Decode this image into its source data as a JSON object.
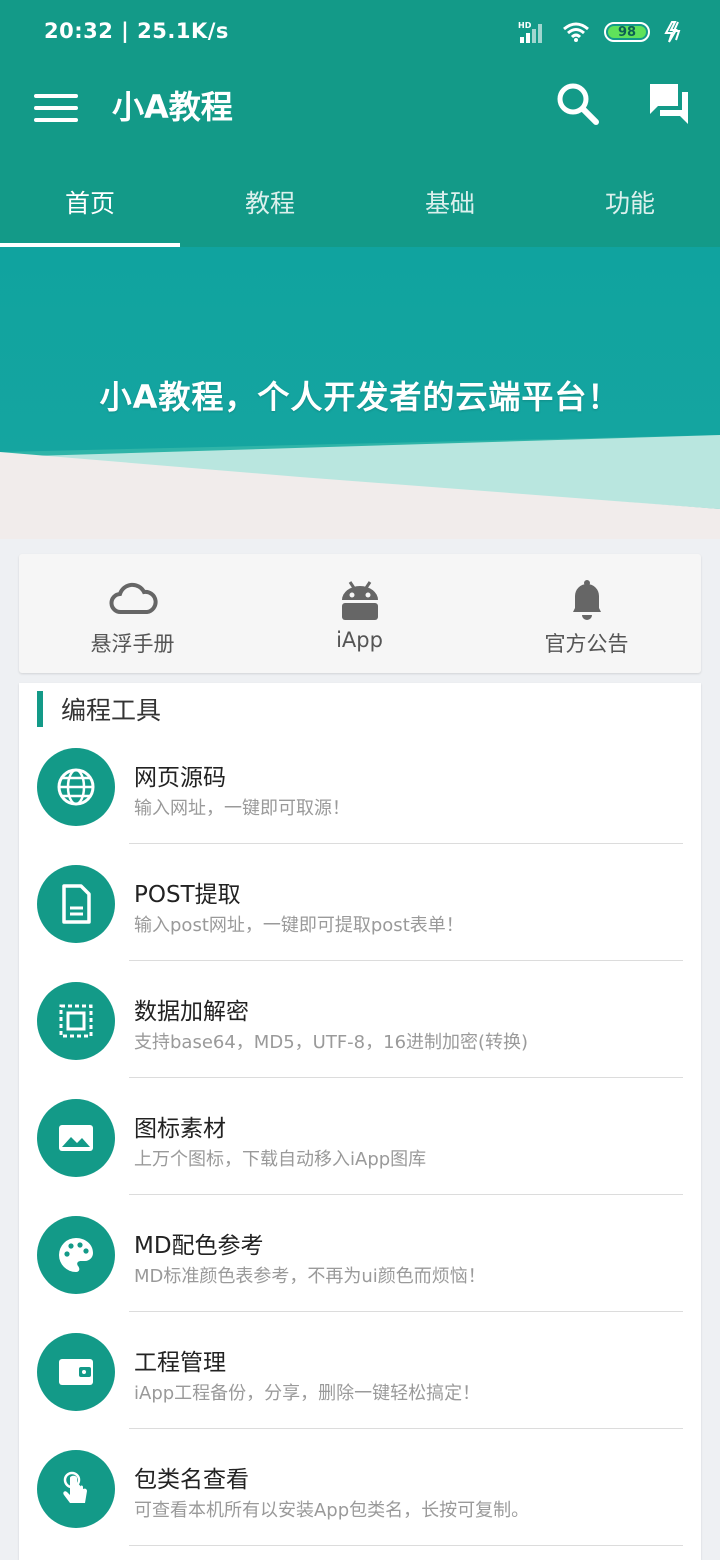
{
  "status_bar": {
    "time": "20:32 | 25.1K/s",
    "network": "HD",
    "battery": "98"
  },
  "app_bar": {
    "title": "小A教程",
    "menu_icon": "hamburger-menu-icon",
    "search_icon": "search-icon",
    "chat_icon": "chat-bubbles-icon"
  },
  "tabs": [
    {
      "label": "首页",
      "active": true
    },
    {
      "label": "教程",
      "active": false
    },
    {
      "label": "基础",
      "active": false
    },
    {
      "label": "功能",
      "active": false
    }
  ],
  "banner": {
    "text": "小A教程，个人开发者的云端平台！"
  },
  "quick_menu": [
    {
      "label": "悬浮手册",
      "icon": "cloud-icon"
    },
    {
      "label": "iApp",
      "icon": "android-icon"
    },
    {
      "label": "官方公告",
      "icon": "bell-icon"
    }
  ],
  "tools_section": {
    "title": "编程工具",
    "items": [
      {
        "title": "网页源码",
        "subtitle": "输入网址，一键即可取源！",
        "icon": "globe-icon"
      },
      {
        "title": "POST提取",
        "subtitle": "输入post网址，一键即可提取post表单！",
        "icon": "document-icon"
      },
      {
        "title": "数据加解密",
        "subtitle": "支持base64，MD5，UTF-8，16进制加密(转换)",
        "icon": "chip-icon"
      },
      {
        "title": "图标素材",
        "subtitle": "上万个图标，下载自动移入iApp图库",
        "icon": "image-icon"
      },
      {
        "title": "MD配色参考",
        "subtitle": "MD标准颜色表参考，不再为ui颜色而烦恼！",
        "icon": "palette-icon"
      },
      {
        "title": "工程管理",
        "subtitle": "iApp工程备份，分享，删除一键轻松搞定！",
        "icon": "wallet-icon"
      },
      {
        "title": "包类名查看",
        "subtitle": "可查看本机所有以安装App包类名，长按可复制。",
        "icon": "touch-icon"
      }
    ]
  },
  "colors": {
    "primary": "#139a88",
    "banner_top": "#0e9ea2",
    "banner_light": "#b9e6df",
    "banner_bottom": "#f1eceb"
  }
}
